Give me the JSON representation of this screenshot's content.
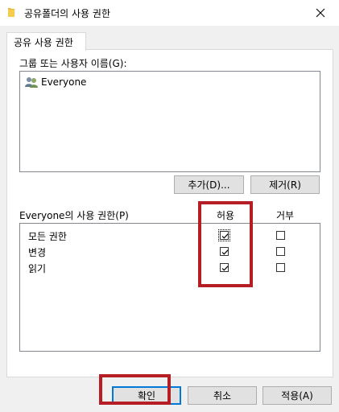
{
  "window": {
    "title": "공유폴더의 사용 권한"
  },
  "tab": {
    "label": "공유 사용 권한"
  },
  "groups": {
    "label": "그룹 또는 사용자 이름(G):",
    "items": [
      {
        "name": "Everyone",
        "icon": "users-icon"
      }
    ],
    "add_button": "추가(D)...",
    "remove_button": "제거(R)"
  },
  "permissions": {
    "label": "Everyone의 사용 권한(P)",
    "allow_header": "허용",
    "deny_header": "거부",
    "rows": [
      {
        "name": "모든 권한",
        "allow": true,
        "deny": false
      },
      {
        "name": "변경",
        "allow": true,
        "deny": false
      },
      {
        "name": "읽기",
        "allow": true,
        "deny": false
      }
    ]
  },
  "footer": {
    "ok_button": "확인",
    "cancel_button": "취소",
    "apply_button": "적용(A)"
  },
  "colors": {
    "highlight": "#b41e24",
    "accent": "#0078d7"
  }
}
